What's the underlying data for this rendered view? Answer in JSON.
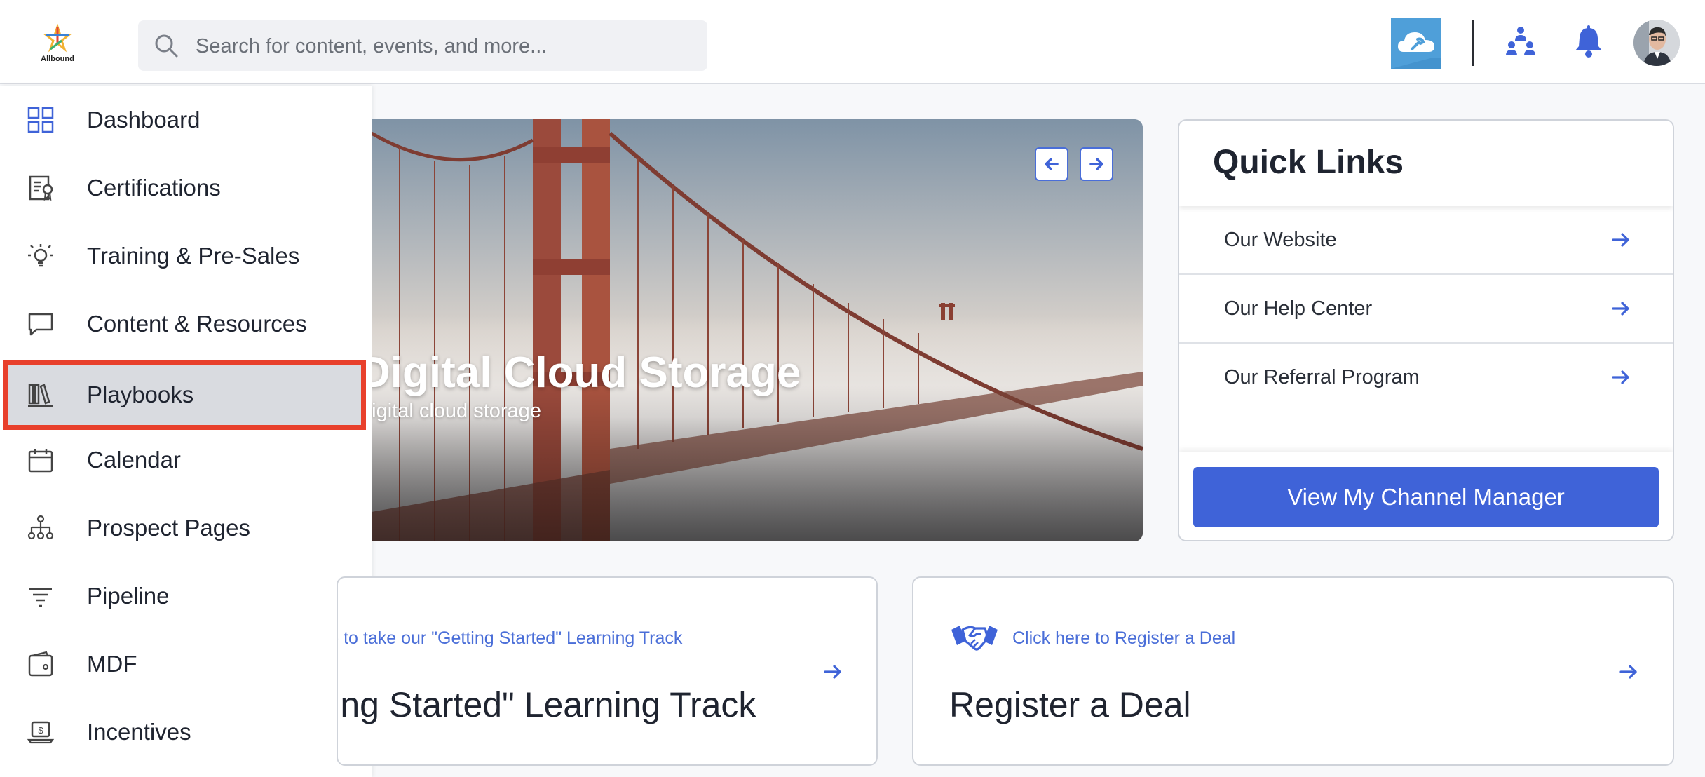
{
  "header": {
    "logo_text": "Allbound",
    "search_placeholder": "Search for content, events, and more..."
  },
  "sidebar": {
    "items": [
      {
        "label": "Dashboard",
        "icon": "dashboard-icon"
      },
      {
        "label": "Certifications",
        "icon": "certificate-icon"
      },
      {
        "label": "Training & Pre-Sales",
        "icon": "lightbulb-icon"
      },
      {
        "label": "Content & Resources",
        "icon": "chat-bubble-icon"
      },
      {
        "label": "Playbooks",
        "icon": "library-icon",
        "active": true
      },
      {
        "label": "Calendar",
        "icon": "calendar-icon"
      },
      {
        "label": "Prospect Pages",
        "icon": "hierarchy-icon"
      },
      {
        "label": "Pipeline",
        "icon": "filter-icon"
      },
      {
        "label": "MDF",
        "icon": "wallet-icon"
      },
      {
        "label": "Incentives",
        "icon": "laptop-dollar-icon"
      }
    ]
  },
  "hero": {
    "title": "Digital Cloud Storage",
    "subtitle": "digital cloud storage"
  },
  "quick_links": {
    "title": "Quick Links",
    "links": [
      {
        "label": "Our Website"
      },
      {
        "label": "Our Help Center"
      },
      {
        "label": "Our Referral Program"
      }
    ],
    "button_label": "View My Channel Manager"
  },
  "cards": [
    {
      "link": "Click here to take our \"Getting Started\" Learning Track",
      "title": "\"Getting Started\" Learning Track"
    },
    {
      "link": "Click here to Register a Deal",
      "title": "Register a Deal"
    }
  ],
  "colors": {
    "accent": "#3f63d8",
    "highlight_outline": "#e8402c"
  }
}
